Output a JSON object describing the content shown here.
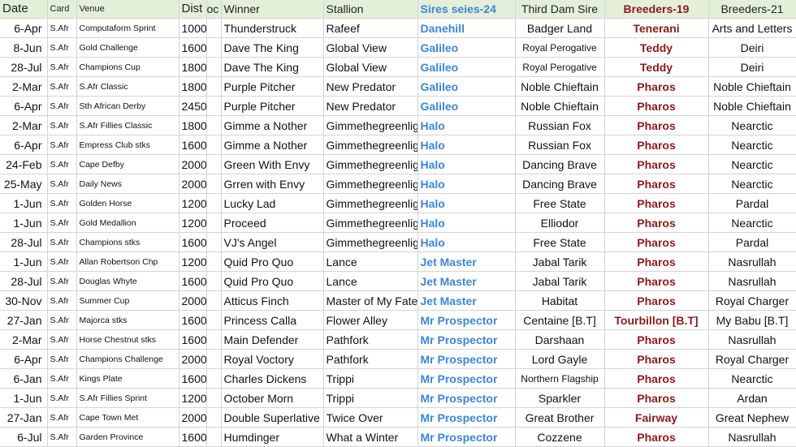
{
  "headers": {
    "date": "Date",
    "card": "Card",
    "venue": "Venue",
    "dist": "Dist",
    "oc": "oc",
    "winner": "Winner",
    "stallion": "Stallion",
    "sires": "Sires seies-24",
    "third_dam_sire": "Third Dam Sire",
    "breeders19": "Breeders-19",
    "breeders21": "Breeders-21"
  },
  "rows": [
    {
      "date": "6-Apr",
      "card": "S.Afr",
      "venue": "Computaform Sprint",
      "dist": "1000",
      "winner": "Thunderstruck",
      "stallion": "Rafeef",
      "sire": "Danehill",
      "third": "Badger Land",
      "b19": "Tenerani",
      "b21": "Arts and Letters"
    },
    {
      "date": "8-Jun",
      "card": "S.Afr",
      "venue": "Gold Challenge",
      "dist": "1600",
      "winner": "Dave The King",
      "stallion": "Global View",
      "sire": "Galileo",
      "third": "Royal Perogative",
      "b19": "Teddy",
      "b21": "Deiri"
    },
    {
      "date": "28-Jul",
      "card": "S.Afr",
      "venue": "Champions Cup",
      "dist": "1800",
      "winner": "Dave The King",
      "stallion": "Global View",
      "sire": "Galileo",
      "third": "Royal Perogative",
      "b19": "Teddy",
      "b21": "Deiri"
    },
    {
      "date": "2-Mar",
      "card": "S.Afr",
      "venue": "S.Afr Classic",
      "dist": "1800",
      "winner": "Purple Pitcher",
      "stallion": "New Predator",
      "sire": "Galileo",
      "third": "Noble Chieftain",
      "b19": "Pharos",
      "b21": "Noble Chieftain"
    },
    {
      "date": "6-Apr",
      "card": "S.Afr",
      "venue": "Sth African Derby",
      "dist": "2450",
      "winner": "Purple Pitcher",
      "stallion": "New Predator",
      "sire": "Galileo",
      "third": "Noble Chieftain",
      "b19": "Pharos",
      "b21": "Noble Chieftain"
    },
    {
      "date": "2-Mar",
      "card": "S.Afr",
      "venue": "S.Afr Fillies Classic",
      "dist": "1800",
      "winner": "Gimme a Nother",
      "stallion": "Gimmethegreenlight",
      "sire": "Halo",
      "third": "Russian Fox",
      "b19": "Pharos",
      "b21": "Nearctic"
    },
    {
      "date": "6-Apr",
      "card": "S.Afr",
      "venue": "Empress Club stks",
      "dist": "1600",
      "winner": "Gimme a Nother",
      "stallion": "Gimmethegreenlight",
      "sire": "Halo",
      "third": "Russian Fox",
      "b19": "Pharos",
      "b21": "Nearctic"
    },
    {
      "date": "24-Feb",
      "card": "S.Afr",
      "venue": "Cape Defby",
      "dist": "2000",
      "winner": "Green With Envy",
      "stallion": "Gimmethegreenlight",
      "sire": "Halo",
      "third": "Dancing Brave",
      "b19": "Pharos",
      "b21": "Nearctic"
    },
    {
      "date": "25-May",
      "card": "S.Afr",
      "venue": "Daily News",
      "dist": "2000",
      "winner": "Grren with Envy",
      "stallion": "Gimmethegreenlight",
      "sire": "Halo",
      "third": "Dancing Brave",
      "b19": "Pharos",
      "b21": "Nearctic"
    },
    {
      "date": "1-Jun",
      "card": "S.Afr",
      "venue": "Golden Horse",
      "dist": "1200",
      "winner": "Lucky Lad",
      "stallion": "Gimmethegreenlight",
      "sire": "Halo",
      "third": "Free State",
      "b19": "Pharos",
      "b21": "Pardal"
    },
    {
      "date": "1-Jun",
      "card": "S.Afr",
      "venue": "Gold Medallion",
      "dist": "1200",
      "winner": "Proceed",
      "stallion": "Gimmethegreenlight",
      "sire": "Halo",
      "third": "Elliodor",
      "b19": "Pharos",
      "b21": "Nearctic"
    },
    {
      "date": "28-Jul",
      "card": "S.Afr",
      "venue": "Champions stks",
      "dist": "1600",
      "winner": "VJ's Angel",
      "stallion": "Gimmethegreenlight",
      "sire": "Halo",
      "third": "Free State",
      "b19": "Pharos",
      "b21": "Pardal"
    },
    {
      "date": "1-Jun",
      "card": "S.Afr",
      "venue": "Allan Robertson Chp",
      "dist": "1200",
      "winner": "Quid Pro Quo",
      "stallion": "Lance",
      "sire": "Jet Master",
      "third": "Jabal Tarik",
      "b19": "Pharos",
      "b21": "Nasrullah"
    },
    {
      "date": "28-Jul",
      "card": "S.Afr",
      "venue": "Douglas Whyte",
      "dist": "1600",
      "winner": "Quid Pro Quo",
      "stallion": "Lance",
      "sire": "Jet Master",
      "third": "Jabal Tarik",
      "b19": "Pharos",
      "b21": "Nasrullah"
    },
    {
      "date": "30-Nov",
      "card": "S.Afr",
      "venue": "Summer Cup",
      "dist": "2000",
      "winner": "Atticus Finch",
      "stallion": "Master of My Fate",
      "sire": "Jet Master",
      "third": "Habitat",
      "b19": "Pharos",
      "b21": "Royal Charger"
    },
    {
      "date": "27-Jan",
      "card": "S.Afr",
      "venue": "Majorca stks",
      "dist": "1600",
      "winner": "Princess Calla",
      "stallion": "Flower Alley",
      "sire": "Mr Prospector",
      "third": "Centaine [B.T]",
      "b19": "Tourbillon [B.T]",
      "b21": "My Babu [B.T]"
    },
    {
      "date": "2-Mar",
      "card": "S.Afr",
      "venue": "Horse Chestnut stks",
      "dist": "1600",
      "winner": "Main Defender",
      "stallion": "Pathfork",
      "sire": "Mr Prospector",
      "third": "Darshaan",
      "b19": "Pharos",
      "b21": "Nasrullah"
    },
    {
      "date": "6-Apr",
      "card": "S.Afr",
      "venue": "Champions Challenge",
      "dist": "2000",
      "winner": "Royal Voctory",
      "stallion": "Pathfork",
      "sire": "Mr Prospector",
      "third": "Lord Gayle",
      "b19": "Pharos",
      "b21": "Royal Charger"
    },
    {
      "date": "6-Jan",
      "card": "S.Afr",
      "venue": "Kings Plate",
      "dist": "1600",
      "winner": "Charles Dickens",
      "stallion": "Trippi",
      "sire": "Mr Prospector",
      "third": "Northern Flagship",
      "b19": "Pharos",
      "b21": "Nearctic"
    },
    {
      "date": "1-Jun",
      "card": "S.Afr",
      "venue": "S.Afr Fillies Sprint",
      "dist": "1200",
      "winner": "October Morn",
      "stallion": "Trippi",
      "sire": "Mr Prospector",
      "third": "Sparkler",
      "b19": "Pharos",
      "b21": "Ardan"
    },
    {
      "date": "27-Jan",
      "card": "S.Afr",
      "venue": "Cape Town Met",
      "dist": "2000",
      "winner": "Double Superlative",
      "stallion": "Twice Over",
      "sire": "Mr Prospector",
      "third": "Great Brother",
      "b19": "Fairway",
      "b21": "Great Nephew"
    },
    {
      "date": "6-Jul",
      "card": "S.Afr",
      "venue": "Garden Province",
      "dist": "1600",
      "winner": "Humdinger",
      "stallion": "What a Winter",
      "sire": "Mr Prospector",
      "third": "Cozzene",
      "b19": "Pharos",
      "b21": "Nasrullah"
    }
  ]
}
